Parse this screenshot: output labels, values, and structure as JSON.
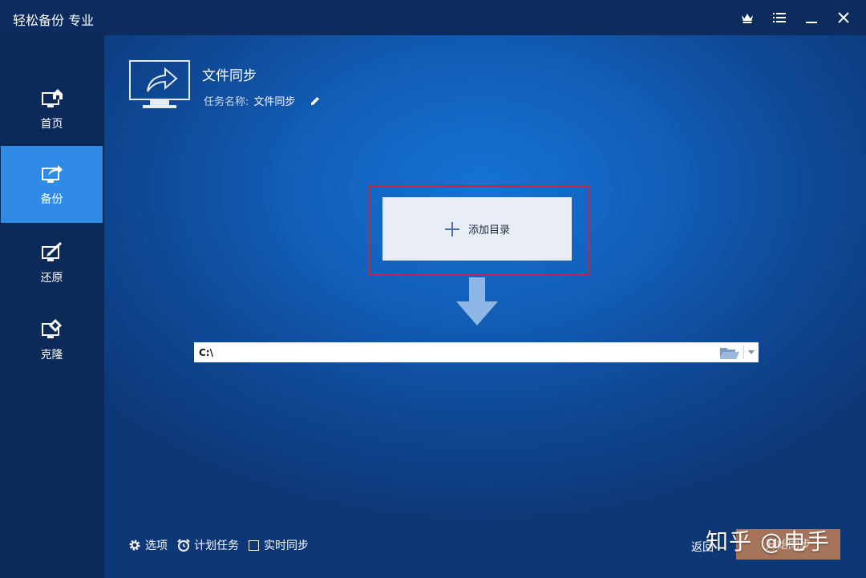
{
  "titlebar": {
    "title": "轻松备份 专业",
    "icons": [
      "crown-icon",
      "menu-icon",
      "minimize-icon",
      "close-icon"
    ]
  },
  "sidebar": {
    "items": [
      {
        "label": "首页",
        "icon": "home-monitor-icon",
        "active": false
      },
      {
        "label": "备份",
        "icon": "backup-monitor-icon",
        "active": true
      },
      {
        "label": "还原",
        "icon": "restore-monitor-icon",
        "active": false
      },
      {
        "label": "克隆",
        "icon": "clone-monitor-icon",
        "active": false
      }
    ],
    "active_color": "#2f8be6"
  },
  "main": {
    "title": "文件同步",
    "task_label": "任务名称:",
    "task_name": "文件同步",
    "add_directory_label": "添加目录",
    "destination_path": "C:\\"
  },
  "bottom": {
    "options_label": "选项",
    "schedule_label": "计划任务",
    "realtime_sync_label": "实时同步",
    "realtime_sync_checked": false,
    "back_label": "返回",
    "start_label": "开始同步"
  },
  "watermark": "知乎 @电手",
  "colors": {
    "highlight_border": "#c8243a",
    "start_button": "#a6745a"
  }
}
